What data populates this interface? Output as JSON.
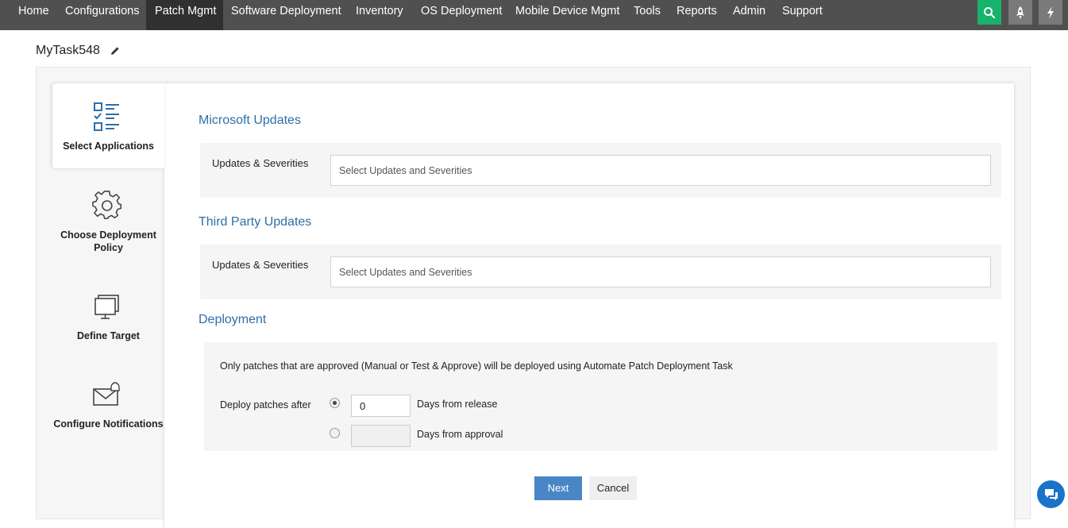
{
  "nav": {
    "items": [
      {
        "label": "Home",
        "active": false
      },
      {
        "label": "Configurations",
        "active": false
      },
      {
        "label": "Patch Mgmt",
        "active": true
      },
      {
        "label": "Software Deployment",
        "active": false
      },
      {
        "label": "Inventory",
        "active": false
      },
      {
        "label": "OS Deployment",
        "active": false
      },
      {
        "label": "Mobile Device Mgmt",
        "active": false
      },
      {
        "label": "Tools",
        "active": false
      },
      {
        "label": "Reports",
        "active": false
      },
      {
        "label": "Admin",
        "active": false
      },
      {
        "label": "Support",
        "active": false
      }
    ],
    "buttons": [
      {
        "icon": "search-icon",
        "color": "#18b36a"
      },
      {
        "icon": "rocket-icon",
        "color": "#7a7a7a"
      },
      {
        "icon": "lightning-icon",
        "color": "#7a7a7a"
      }
    ]
  },
  "task": {
    "title": "MyTask548"
  },
  "steps": [
    {
      "label": "Select Applications",
      "icon": "checklist-icon",
      "active": true
    },
    {
      "label": "Choose Deployment Policy",
      "icon": "gear-icon",
      "active": false
    },
    {
      "label": "Define Target",
      "icon": "monitor-icon",
      "active": false
    },
    {
      "label": "Configure Notifications",
      "icon": "envelope-icon",
      "active": false
    }
  ],
  "microsoft": {
    "title": "Microsoft Updates",
    "field_label": "Updates & Severities",
    "placeholder": "Select Updates and Severities"
  },
  "third_party": {
    "title": "Third Party Updates",
    "field_label": "Updates & Severities",
    "placeholder": "Select Updates and Severities"
  },
  "deployment": {
    "title": "Deployment",
    "note": "Only patches that are approved (Manual or Test & Approve) will be deployed using Automate Patch Deployment Task",
    "deploy_label": "Deploy patches after",
    "options": [
      {
        "value": "0",
        "label": "Days from release",
        "checked": true
      },
      {
        "value": "",
        "label": "Days from approval",
        "checked": false
      }
    ]
  },
  "buttons": {
    "next": "Next",
    "cancel": "Cancel"
  },
  "colors": {
    "accent": "#4a86c5",
    "section_title": "#2d6fa8",
    "nav_bg": "#505050",
    "nav_active": "#303030"
  }
}
